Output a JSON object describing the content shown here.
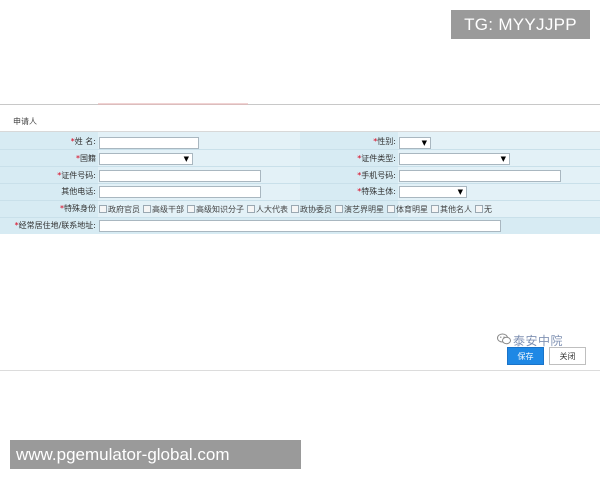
{
  "watermarks": {
    "tg": "TG: MYYJJPP",
    "url": "www.pgemulator-global.com"
  },
  "dialog": {
    "title": "申请人"
  },
  "form": {
    "name_label": "姓 名:",
    "gender_label": "性别:",
    "gender_value": "",
    "nationality_label": "国籍",
    "nationality_value": "",
    "id_type_label": "证件类型:",
    "id_type_value": "",
    "id_number_label": "证件号码:",
    "mobile_label": "手机号码:",
    "other_phone_label": "其他电话:",
    "special_subject_label": "特殊主体:",
    "special_subject_value": "",
    "special_identity_label": "特殊身份",
    "special_identity_options": [
      "政府官员",
      "高级干部",
      "高级知识分子",
      "人大代表",
      "政协委员",
      "演艺界明星",
      "体育明星",
      "其他名人",
      "无"
    ],
    "address_label": "经常居住地/联系地址:",
    "required_mark": "*"
  },
  "footer": {
    "logo_text": "泰安中院",
    "save_label": "保存",
    "close_label": "关闭"
  },
  "colors": {
    "form_bg": "#d7ebf3",
    "required": "#d9001b",
    "save_button": "#1e88e5"
  }
}
